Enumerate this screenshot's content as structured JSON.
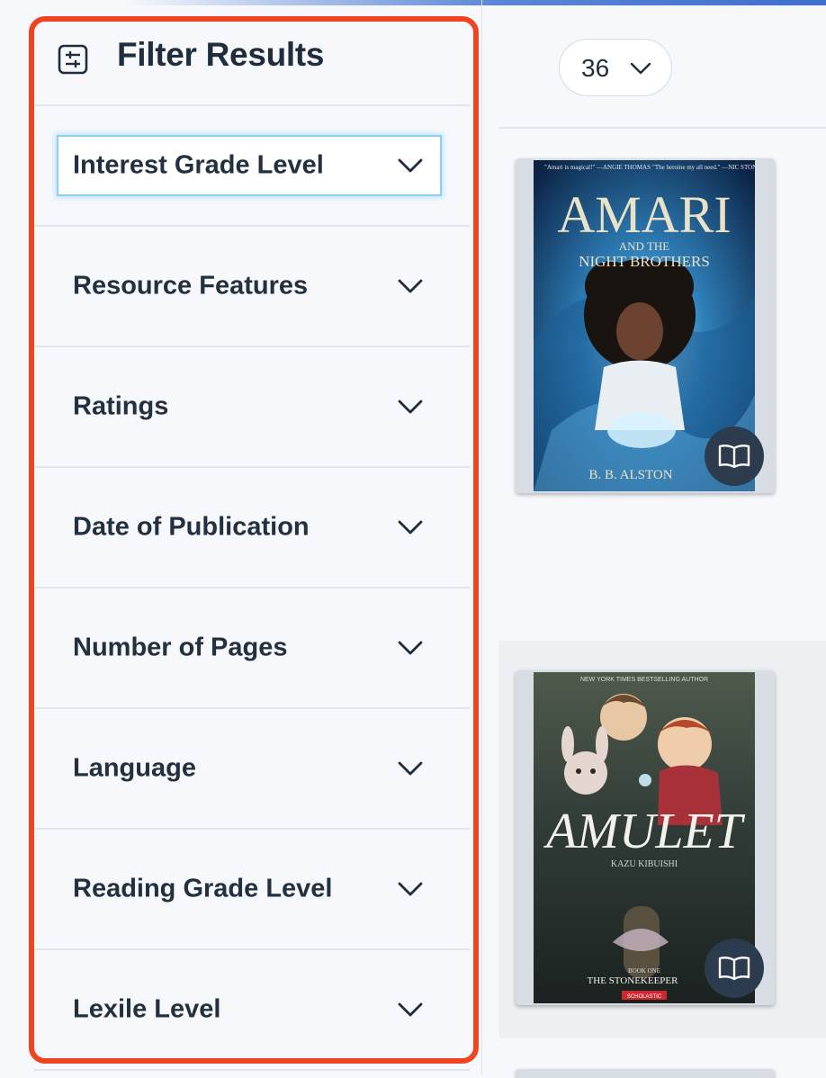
{
  "sidebar": {
    "title": "Filter Results",
    "filters": [
      {
        "label": "Interest Grade Level",
        "focused": true
      },
      {
        "label": "Resource Features"
      },
      {
        "label": "Ratings"
      },
      {
        "label": "Date of Publication"
      },
      {
        "label": "Number of Pages"
      },
      {
        "label": "Language"
      },
      {
        "label": "Reading Grade Level"
      },
      {
        "label": "Lexile Level"
      }
    ]
  },
  "main": {
    "per_page": "36",
    "books": [
      {
        "title_line1": "AMARI",
        "title_line2": "AND THE",
        "title_line3": "NIGHT BROTHERS",
        "author": "B. B. ALSTON",
        "blurb_left": "\"Amari is magical!\" —ANGIE THOMAS",
        "blurb_right": "\"The heroine my all need.\" —NIC STONE"
      },
      {
        "banner": "NEW YORK TIMES BESTSELLING AUTHOR",
        "title": "AMULET",
        "subtitle": "KAZU KIBUISHI",
        "book_line": "BOOK ONE",
        "series": "THE STONEKEEPER",
        "publisher": "SCHOLASTIC"
      }
    ]
  },
  "colors": {
    "highlight": "#ef4423",
    "focus_ring": "#8ccff2",
    "read_button": "#2d3b4f",
    "text": "#1f2d3d"
  },
  "icons": {
    "filter": "sliders-icon",
    "chevron": "chevron-down-icon",
    "read": "open-book-icon"
  }
}
